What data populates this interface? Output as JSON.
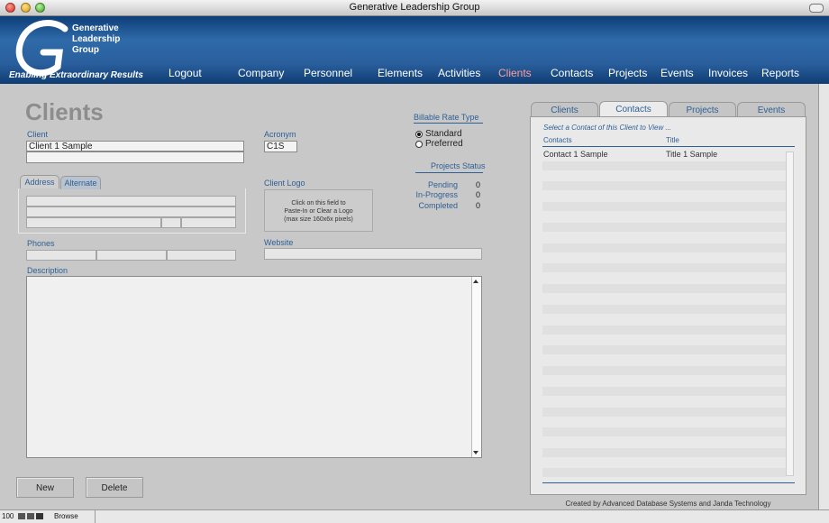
{
  "window": {
    "title": "Generative Leadership Group"
  },
  "brand": {
    "logo_lines": [
      "Generative",
      "Leadership",
      "Group"
    ],
    "tagline": "Enabling Extraordinary Results"
  },
  "nav": [
    "Logout",
    "Company",
    "Personnel",
    "Elements",
    "Activities",
    "Clients",
    "Contacts",
    "Projects",
    "Events",
    "Invoices",
    "Reports"
  ],
  "nav_active": "Clients",
  "page": {
    "title": "Clients"
  },
  "form": {
    "client_label": "Client",
    "client_value": "Client 1 Sample",
    "acronym_label": "Acronym",
    "acronym_value": "C1S",
    "billable_rate_label": "Billable Rate Type",
    "rate_options": [
      {
        "label": "Standard",
        "selected": true
      },
      {
        "label": "Preferred",
        "selected": false
      }
    ],
    "address_tabs": [
      "Address",
      "Alternate"
    ],
    "client_logo_label": "Client Logo",
    "client_logo_hint": [
      "Click on this field to",
      "Paste-In or Clear a Logo",
      "(max size 160x6x pixels)"
    ],
    "projects_status_label": "Projects Status",
    "projects_status": [
      {
        "label": "Pending",
        "value": "0"
      },
      {
        "label": "In-Progress",
        "value": "0"
      },
      {
        "label": "Completed",
        "value": "0"
      }
    ],
    "phones_label": "Phones",
    "website_label": "Website",
    "description_label": "Description"
  },
  "buttons": {
    "new": "New",
    "delete": "Delete"
  },
  "right_panel": {
    "tabs": [
      "Clients",
      "Contacts",
      "Projects",
      "Events"
    ],
    "active_tab": "Contacts",
    "hint": "Select a Contact of this Client to View ...",
    "columns": [
      "Contacts",
      "Title"
    ],
    "rows": [
      {
        "contact": "Contact 1 Sample",
        "title": "Title 1 Sample"
      }
    ]
  },
  "credit": "Created by Advanced Database Systems and Janda Technology",
  "status_bar": {
    "zoom": "100",
    "mode": "Browse"
  },
  "colors": {
    "header_blue": "#2f6aa9",
    "label_blue": "#2e5f95",
    "active_nav": "#ff9f9a"
  }
}
